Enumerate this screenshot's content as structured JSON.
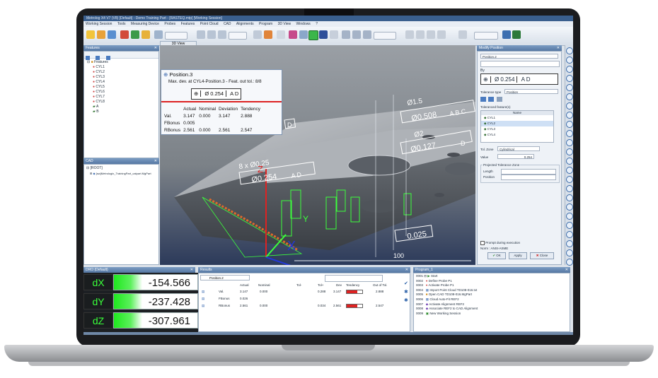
{
  "app": {
    "title": "Metrolog X4 V7 (V8) [Default] - Demo Training Part - [RASTEQ.mtp] [Working Session]",
    "menu": [
      "Working Session",
      "Tools",
      "Measuring Device",
      "Probes",
      "Features",
      "Point Cloud",
      "CAD",
      "Alignments",
      "Program",
      "3D View",
      "Windows",
      "?"
    ]
  },
  "features_panel": {
    "title": "Features",
    "root": "Features",
    "items": [
      "CYL1",
      "CYL2",
      "CYL3",
      "CYL4",
      "CYL5",
      "CYL6",
      "CYL7",
      "CYL8",
      "A",
      "B"
    ]
  },
  "cad_panel": {
    "title": "CAD",
    "items": [
      "[ROOT]",
      "[sw]Metrologix_TrainingPart_catpart.MgPart"
    ]
  },
  "viewport": {
    "tab": "3D View",
    "axis_z": "Z",
    "axis_y": "Y",
    "axis_x": "X",
    "dims": {
      "dim_100": "100",
      "dim_15": "Ø1.5",
      "dim_2": "Ø2",
      "dim_8x": "8 x Ø0.25",
      "dim_025": "0.025"
    },
    "callouts": {
      "top_tol": "Ø0.508",
      "top_refs": "A B C",
      "mid_tol": "Ø0.127",
      "mid_refs": "D",
      "bot_tol": "Ø0.254",
      "bot_refs": "A D",
      "d_label": "D"
    }
  },
  "position_box": {
    "title": "Position.3",
    "subtitle": "Max. dev. at CYL4-Position.3 - Feat. out tol.: 8/8",
    "tol_value": "Ø 0.254",
    "tol_refs": "A D",
    "columns": [
      "",
      "Actual",
      "Nominal",
      "Deviation",
      "Tendency"
    ],
    "rows": [
      [
        "Val.",
        "3.147",
        "0.000",
        "3.147",
        "2.888"
      ],
      [
        "FBonus",
        "0.005",
        "",
        "",
        ""
      ],
      [
        "RBonus",
        "2.561",
        "0.000",
        "2.561",
        "2.547"
      ]
    ]
  },
  "modify_position": {
    "title": "Modify Position",
    "name": "Position.2",
    "by_label": "By",
    "tol_value": "Ø 0.254",
    "tol_refs": "A D",
    "tolerance_type_label": "Tolerance type",
    "tolerance_type_value": "Position",
    "features_label": "Toleranced feature(s)",
    "features_col": "Name",
    "features": [
      "CYL1",
      "CYL2",
      "CYL3",
      "CYL4"
    ],
    "zone_label": "Tol. Zone",
    "zone_value": "Cylindrical",
    "value_label": "Value",
    "value": "0.254",
    "projected_label": "Projected Tolerance Zone",
    "length_label": "Length",
    "position_label": "Position",
    "prompt_label": "Prompt during execution",
    "norm_label": "Norm : ANSI-ASME",
    "ok_label": "OK",
    "apply_label": "Apply",
    "close_label": "Close"
  },
  "dro": {
    "title": "DRO (Default)",
    "rows": [
      {
        "label": "dX",
        "value": "-154.566"
      },
      {
        "label": "dY",
        "value": "-237.428"
      },
      {
        "label": "dZ",
        "value": "-307.961"
      }
    ]
  },
  "results": {
    "title": "Results",
    "selector": "Position.2",
    "headers": [
      "Actual",
      "Nominal",
      "Tol-",
      "Tol+",
      "Tol+",
      "Dev",
      "Tendency",
      "Out of Tol."
    ],
    "rows": [
      {
        "name": "Val.",
        "actual": "3.147",
        "nominal": "0.000",
        "tolp": "0.288",
        "dev": "3.147",
        "out": "2.888"
      },
      {
        "name": "FBonus",
        "actual": "0.026",
        "nominal": "",
        "tolp": "",
        "dev": "",
        "out": ""
      },
      {
        "name": "RBonus",
        "actual": "2.561",
        "nominal": "0.000",
        "tolp": "0.034",
        "dev": "2.561",
        "out": "2.547"
      }
    ]
  },
  "program": {
    "title": "Program_1",
    "lines": [
      {
        "n": "0001",
        "text": "Start"
      },
      {
        "n": "0002",
        "text": "Define Probe P1"
      },
      {
        "n": "0003",
        "text": "Activate Probe P1"
      },
      {
        "n": "0004",
        "text": "Import Point Cloud TD108-016.txt"
      },
      {
        "n": "0005",
        "text": "Open CAD TD108-016.MgPart"
      },
      {
        "n": "0006",
        "text": "Cloud Auto-Fit REF2"
      },
      {
        "n": "0007",
        "text": "Activate Alignment REF2"
      },
      {
        "n": "0008",
        "text": "Associate REF2 to CAD Alignment"
      },
      {
        "n": "0009",
        "text": "New Working Session"
      }
    ]
  },
  "colors": {
    "accent": "#3a5f8e",
    "dro_green": "#1ee81e",
    "point_cloud": "#3cff3c",
    "dev_red": "#d22"
  }
}
